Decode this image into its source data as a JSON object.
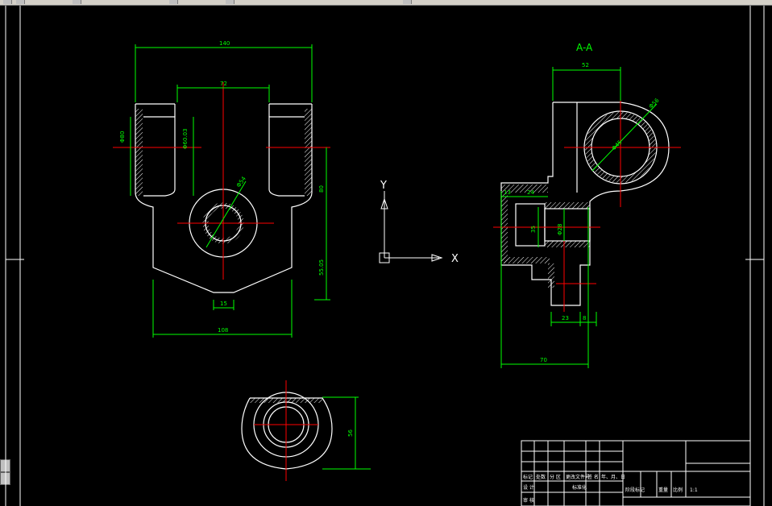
{
  "section_label": "A-A",
  "colors": {
    "outline": "#ffffff",
    "dimension": "#00ff00",
    "centerline": "#ff0000",
    "hatch": "#ffffff",
    "background": "#000000"
  },
  "front_view": {
    "dims": {
      "width_top": "140",
      "inner": "72",
      "bore_left": "Φ80",
      "bore_inner": "Φ60.03",
      "height_right": "80",
      "lower_height": "55.05",
      "tip": "15",
      "bottom_width": "108",
      "hole": "Φ54"
    }
  },
  "section_view": {
    "dims": {
      "top_width": "52",
      "hole_outer": "Φ56",
      "hole_inner": "Φ45",
      "left_13": "13",
      "left_24": "24",
      "bore_35": "35",
      "bore_phi": "Φ28",
      "d23": "23",
      "d8": "8",
      "overall": "70"
    }
  },
  "top_view": {
    "dims": {
      "depth": "56"
    }
  },
  "ucs": {
    "x_label": "X",
    "y_label": "Y"
  },
  "title_block": {
    "row1": [
      "标记",
      "处数",
      "分 区",
      "更改文件号",
      "签 名",
      "年、月、日"
    ],
    "row2_label": "设 计",
    "row2_std": "标准化",
    "row3_label": "审 核",
    "stage_labels": [
      "阶段标记",
      "重量",
      "比例"
    ],
    "scale": "1:1"
  },
  "toolbar": {
    "icons": [
      "open-icon",
      "save-icon",
      "print-icon",
      "undo-icon",
      "redo-icon",
      "zoom-icon"
    ]
  }
}
